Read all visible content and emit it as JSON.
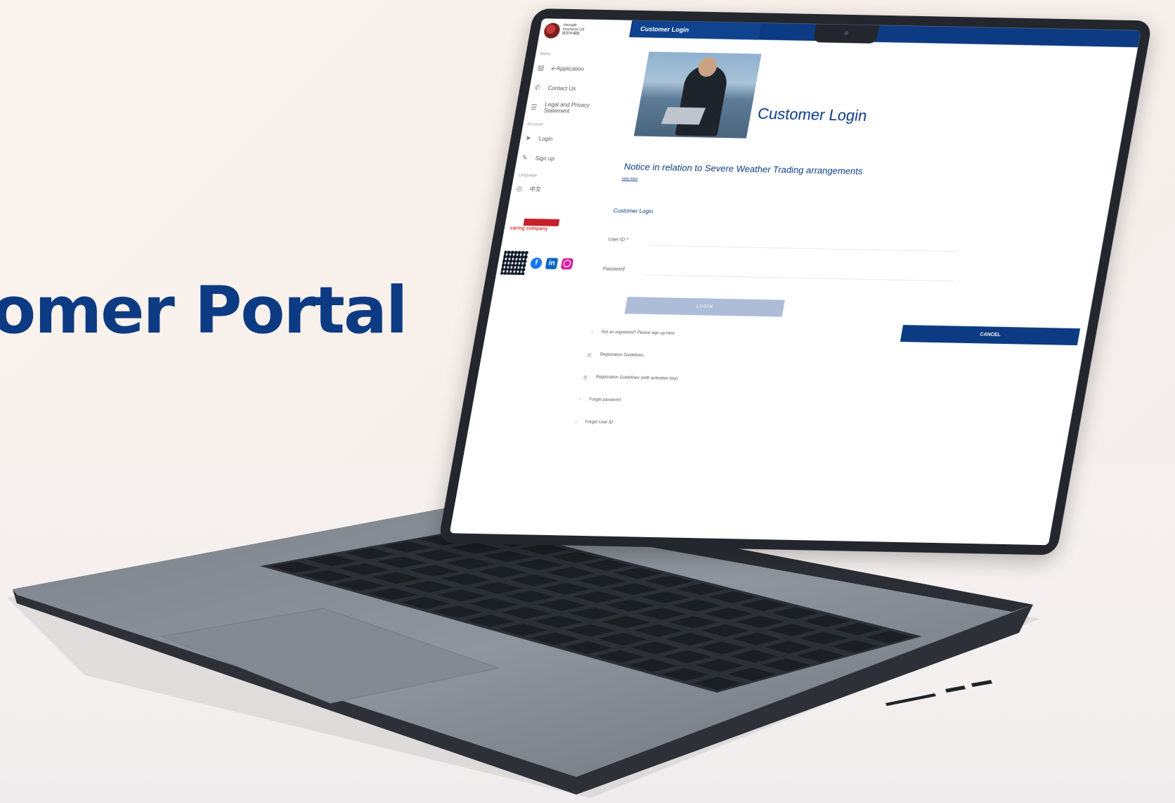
{
  "hero": {
    "title": "omer Portal"
  },
  "screen": {
    "logo_lines": [
      "Heungfe",
      "Insurance Ltd",
      "姓洪平保险"
    ],
    "topbar_tab": "Customer Login",
    "sidebar": {
      "menu_label": "Menu",
      "items": [
        {
          "label": "e-Application",
          "icon": "doc-icon"
        },
        {
          "label": "Contact Us",
          "icon": "phone-icon"
        },
        {
          "label": "Legal and Privacy Statement",
          "icon": "list-icon"
        }
      ],
      "account_label": "Account",
      "account_items": [
        {
          "label": "Login",
          "icon": "login-icon"
        },
        {
          "label": "Sign up",
          "icon": "signup-icon"
        }
      ],
      "language_label": "Language",
      "language_item": "中文",
      "partner_text": "caring company"
    },
    "page_title": "Customer Login",
    "notice_title": "Notice in relation to Severe Weather Trading arrangements",
    "notice_more": "view more",
    "login_heading": "Customer Login",
    "fields": {
      "user_id": "User ID *",
      "password": "Password"
    },
    "login_button": "LOGIN",
    "cancel_button": "CANCEL",
    "links": [
      "Not an registered? Please sign up here",
      "Registration Guidelines",
      "Registration Guidelines (with activation key)",
      "Forget password",
      "Forget User ID"
    ]
  }
}
